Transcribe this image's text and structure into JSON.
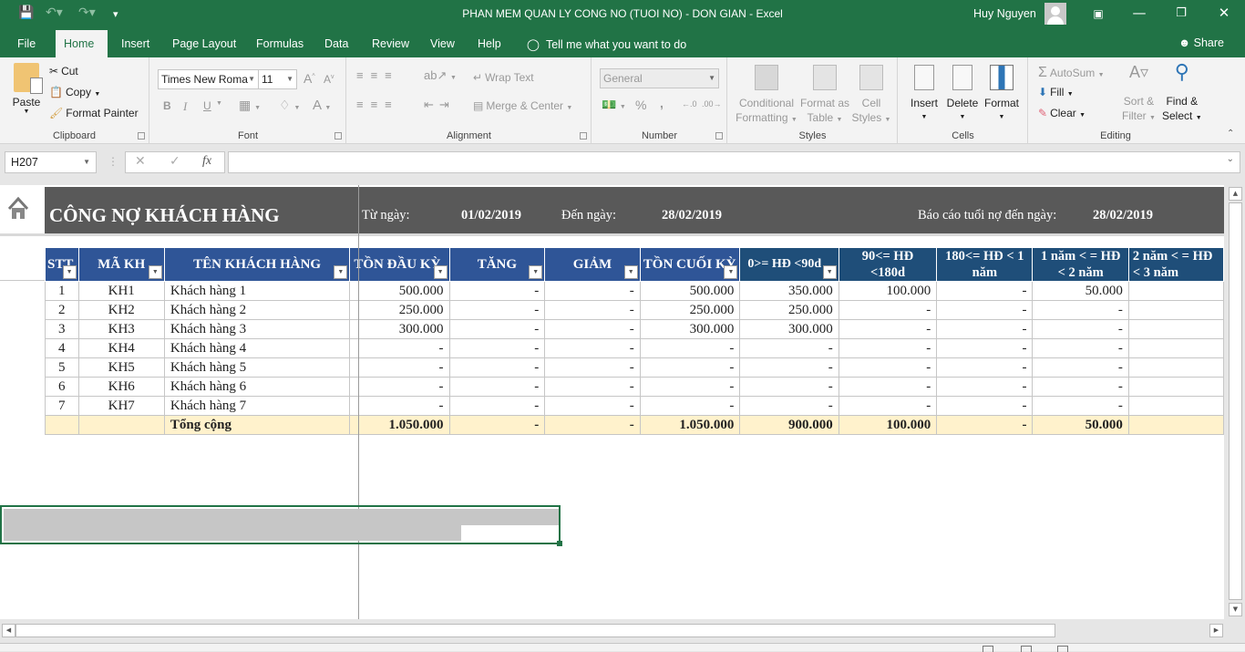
{
  "window": {
    "title": "PHAN MEM QUAN LY CONG NO (TUOI NO) - DON GIAN  -  Excel",
    "user": "Huy Nguyen"
  },
  "quick_access": {
    "save": "save-icon",
    "undo": "undo-icon",
    "redo": "redo-icon",
    "customize": "customize-icon"
  },
  "tabs": [
    "File",
    "Home",
    "Insert",
    "Page Layout",
    "Formulas",
    "Data",
    "Review",
    "View",
    "Help"
  ],
  "active_tab": "Home",
  "tell_me": "Tell me what you want to do",
  "share": "Share",
  "ribbon": {
    "clipboard": {
      "label": "Clipboard",
      "paste": "Paste",
      "cut": "Cut",
      "copy": "Copy",
      "format_painter": "Format Painter"
    },
    "font": {
      "label": "Font",
      "font_name": "Times New Roma",
      "font_size": "11",
      "bold": "B",
      "italic": "I",
      "underline": "U",
      "font_color": "A"
    },
    "alignment": {
      "label": "Alignment",
      "wrap_text": "Wrap Text",
      "merge_center": "Merge & Center"
    },
    "number": {
      "label": "Number",
      "format": "General",
      "percent": "%",
      "comma": ","
    },
    "styles": {
      "label": "Styles",
      "conditional": [
        "Conditional",
        "Formatting"
      ],
      "format_table": [
        "Format as",
        "Table"
      ],
      "cell_styles": [
        "Cell",
        "Styles"
      ]
    },
    "cells": {
      "label": "Cells",
      "insert": "Insert",
      "delete": "Delete",
      "format": "Format"
    },
    "editing": {
      "label": "Editing",
      "autosum": "AutoSum",
      "fill": "Fill",
      "clear": "Clear",
      "sort_filter": [
        "Sort &",
        "Filter"
      ],
      "find_select": [
        "Find &",
        "Select"
      ]
    }
  },
  "formula_bar": {
    "name_box": "H207",
    "formula": "",
    "fx": "fx"
  },
  "sheet": {
    "title": "CÔNG NỢ KHÁCH HÀNG",
    "from_label": "Từ ngày:",
    "from_value": "01/02/2019",
    "to_label": "Đến ngày:",
    "to_value": "28/02/2019",
    "report_label": "Báo cáo tuổi nợ đến ngày:",
    "report_value": "28/02/2019",
    "columns": [
      "STT",
      "MÃ KH",
      "TÊN KHÁCH HÀNG",
      "TỒN ĐẦU KỲ",
      "TĂNG",
      "GIẢM",
      "TỒN CUỐI KỲ",
      "0>= HĐ <90d",
      "90<= HĐ <180d",
      "180<= HĐ < 1 năm",
      "1 năm < = HĐ < 2 năm",
      "2 năm < = HĐ < 3 năm"
    ],
    "rows": [
      [
        "1",
        "KH1",
        "Khách hàng 1",
        "500.000",
        "-",
        "-",
        "500.000",
        "350.000",
        "100.000",
        "-",
        "50.000",
        ""
      ],
      [
        "2",
        "KH2",
        "Khách hàng 2",
        "250.000",
        "-",
        "-",
        "250.000",
        "250.000",
        "-",
        "-",
        "-",
        ""
      ],
      [
        "3",
        "KH3",
        "Khách hàng 3",
        "300.000",
        "-",
        "-",
        "300.000",
        "300.000",
        "-",
        "-",
        "-",
        ""
      ],
      [
        "4",
        "KH4",
        "Khách hàng 4",
        "-",
        "-",
        "-",
        "-",
        "-",
        "-",
        "-",
        "-",
        ""
      ],
      [
        "5",
        "KH5",
        "Khách hàng 5",
        "-",
        "-",
        "-",
        "-",
        "-",
        "-",
        "-",
        "-",
        ""
      ],
      [
        "6",
        "KH6",
        "Khách hàng 6",
        "-",
        "-",
        "-",
        "-",
        "-",
        "-",
        "-",
        "-",
        ""
      ],
      [
        "7",
        "KH7",
        "Khách hàng 7",
        "-",
        "-",
        "-",
        "-",
        "-",
        "-",
        "-",
        "-",
        ""
      ]
    ],
    "total": [
      "",
      "",
      "Tổng cộng",
      "1.050.000",
      "-",
      "-",
      "1.050.000",
      "900.000",
      "100.000",
      "-",
      "50.000",
      ""
    ]
  },
  "colors": {
    "accent": "#217346",
    "header_blue": "#2f5597",
    "header_dark": "#1f4e79",
    "banner": "#595959",
    "total_fill": "#fff2cc"
  }
}
